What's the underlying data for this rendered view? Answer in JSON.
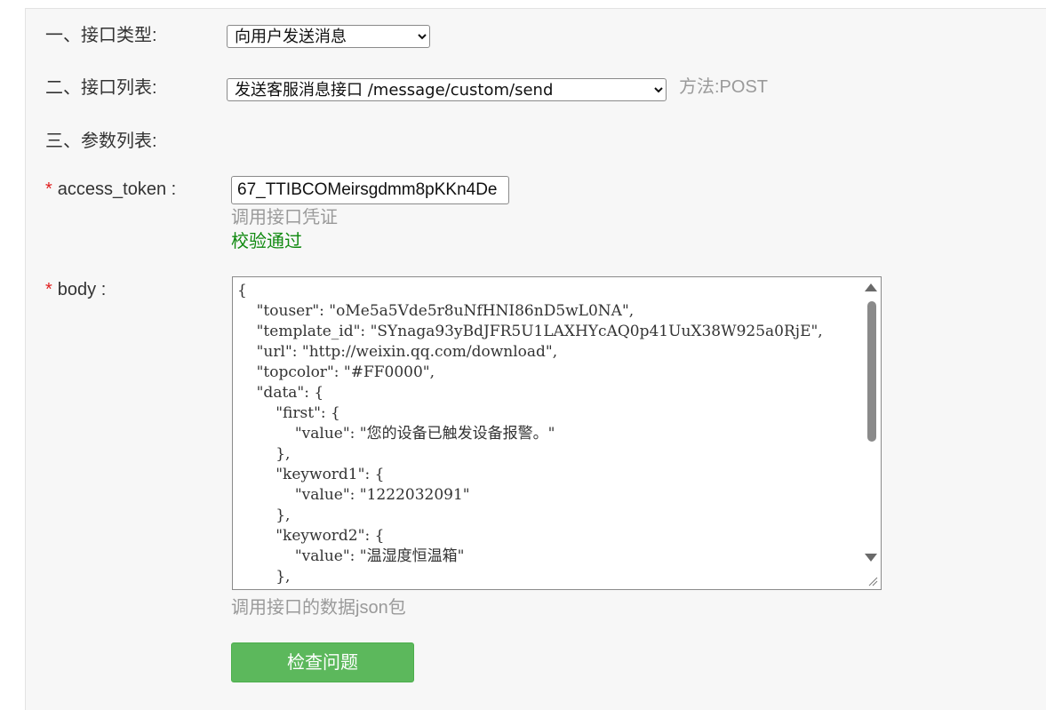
{
  "form": {
    "section1_label": "一、接口类型:",
    "section2_label": "二、接口列表:",
    "section3_label": "三、参数列表:",
    "interface_type": {
      "selected": "向用户发送消息"
    },
    "interface_list": {
      "selected": "发送客服消息接口 /message/custom/send",
      "method_label": "方法:POST"
    },
    "params": {
      "access_token": {
        "required_mark": "*",
        "label": "access_token :",
        "value": "67_TTIBCOMeirsgdmm8pKKn4De",
        "help": "调用接口凭证",
        "status": "校验通过"
      },
      "body": {
        "required_mark": "*",
        "label": "body :",
        "value": "{\n    \"touser\": \"oMe5a5Vde5r8uNfHNI86nD5wL0NA\",\n    \"template_id\": \"SYnaga93yBdJFR5U1LAXHYcAQ0p41UuX38W925a0RjE\",\n    \"url\": \"http://weixin.qq.com/download\",\n    \"topcolor\": \"#FF0000\",\n    \"data\": {\n        \"first\": {\n            \"value\": \"您的设备已触发设备报警。\"\n        },\n        \"keyword1\": {\n            \"value\": \"1222032091\"\n        },\n        \"keyword2\": {\n            \"value\": \"温湿度恒温箱\"\n        },",
        "help": "调用接口的数据json包"
      }
    },
    "check_button": "检查问题"
  },
  "colors": {
    "required": "#e02020",
    "success": "#108a10",
    "button": "#5cb85c",
    "muted": "#9a9a9a"
  }
}
